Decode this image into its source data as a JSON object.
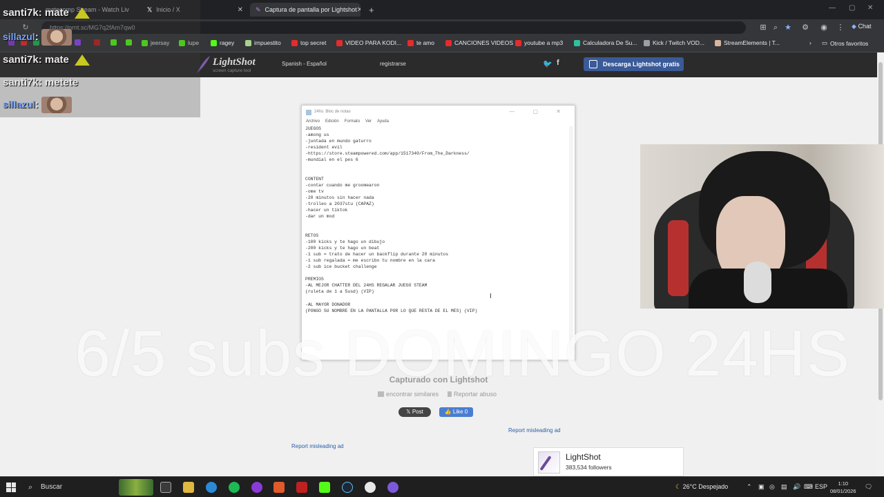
{
  "browser": {
    "tabs": [
      {
        "title": "matecomp Stream - Watch Liv",
        "active": false
      },
      {
        "title": "Inicio / X",
        "active": false
      },
      {
        "title": "Captura de pantalla por Lightshot",
        "active": true
      }
    ],
    "new_tab": "+",
    "url": "https://prnt.sc/MG7q2fAm7qw0",
    "bookmarks": [
      {
        "label": "jeersay",
        "color": "#53fc18"
      },
      {
        "label": "lupe",
        "color": "#53fc18"
      },
      {
        "label": "ragey",
        "color": "#53fc18"
      },
      {
        "label": "impuestito",
        "color": "#a7d28b"
      },
      {
        "label": "top secret",
        "color": "#e82a2a"
      },
      {
        "label": "VIDEO PARA KODI...",
        "color": "#e82a2a"
      },
      {
        "label": "te amo",
        "color": "#e82a2a"
      },
      {
        "label": "CANCIONES VIDEOS",
        "color": "#e82a2a"
      },
      {
        "label": "youtube a mp3",
        "color": "#e82a2a"
      },
      {
        "label": "Calculadora De Su...",
        "color": "#2fc0a0"
      },
      {
        "label": "Kick / Twitch VOD...",
        "color": "#9aa0a6"
      },
      {
        "label": "StreamElements | T...",
        "color": "#d8b59a"
      }
    ],
    "other_favorites": "Otros favoritos",
    "chat_button": "Chat"
  },
  "lightshot": {
    "logo_name": "LightShot",
    "logo_sub": "screen capture tool",
    "language": "Spanish - Español",
    "register": "registrarse",
    "download": "Descarga Lightshot gratis",
    "captured": "Capturado con Lightshot",
    "find_similar": "encontrar similares",
    "report_abuse": "Reportar abuso",
    "x_post": "Post",
    "fb_like": "Like 0",
    "report_ad": "Report misleading ad",
    "card_title": "LightShot",
    "card_followers": "383,534 followers"
  },
  "notepad": {
    "title": "24hs: Bloc de notas",
    "menu": [
      "Archivo",
      "Edición",
      "Formato",
      "Ver",
      "Ayuda"
    ],
    "lines": [
      "JUEGOS",
      "-among us",
      "-juntada en mundo gaturro",
      "-resident evil",
      "-https://store.steampowered.com/app/1517340/From_The_Darkness/",
      "-mundial en el pes 6",
      "",
      "",
      "CONTENT",
      "-contar cuando me groomearon",
      "-ome tv",
      "-20 minutos sin hacer nada",
      "-trolleo a 2037stu (CAPAZ)",
      "-hacer un tiktok",
      "-dar un mod",
      "",
      "",
      "RETOS",
      "-100 kicks y te hago un dibujo",
      "-200 kicks y te hago un beat",
      "-1 sub = trato de hacer un backflip durante 20 minutos",
      "-1 sub regalada = me escribo tu nombre en la cara",
      "-2 sub ice bucket challenge",
      "",
      "PREMIOS",
      "-AL MEJOR CHATTER DEL 24HS REGALAR JUEGO STEAM",
      "(ruleta de 1 a 5usd) (VIP)",
      "",
      "-AL MAYOR DONADOR",
      "(PONGO SU NOMBRE EN LA PANTALLA POR LO QUE RESTA DE EL MES) (VIP)"
    ]
  },
  "stream": {
    "chat": [
      {
        "user": "santi7k",
        "msg": "mate",
        "emote": "hat"
      },
      {
        "user": "sillazul",
        "msg": "",
        "emote": "face"
      },
      {
        "user": "santi7k",
        "msg": "mate",
        "emote": "hat"
      },
      {
        "user": "santi7k",
        "msg": "metete",
        "emote": ""
      },
      {
        "user": "sillazul",
        "msg": "",
        "emote": "face"
      }
    ],
    "overlay_text": "6/5 subs DOMINGO 24HS"
  },
  "taskbar": {
    "search": "Buscar",
    "weather": "26°C  Despejado",
    "lang": "ESP",
    "time": "1:10",
    "date": "08/01/2026"
  }
}
